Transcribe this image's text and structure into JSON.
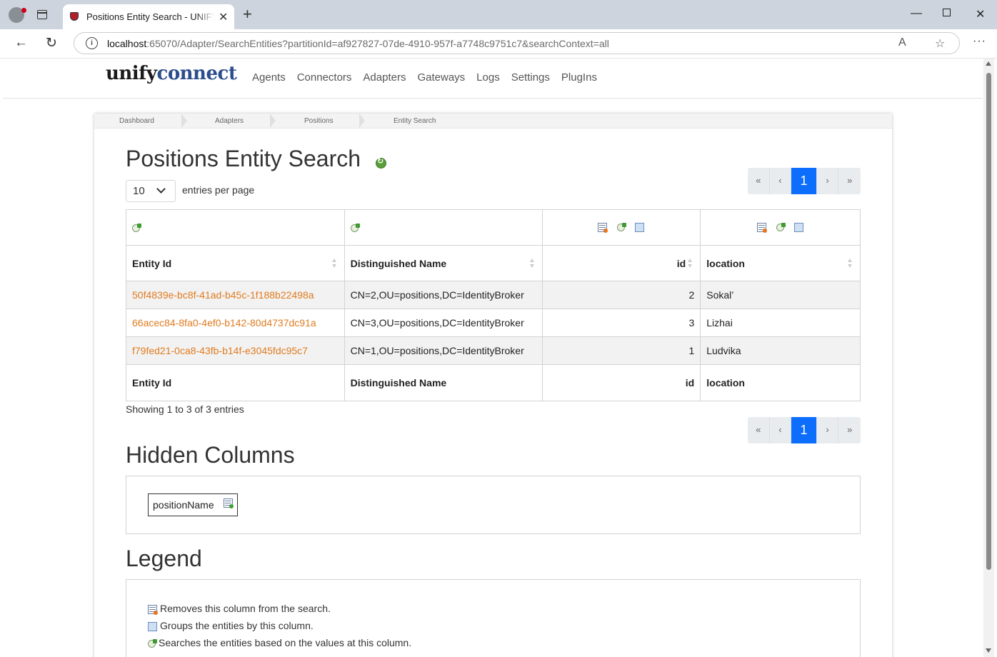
{
  "browser": {
    "tab_title": "Positions Entity Search - UNIFYConnect",
    "url_host": "localhost",
    "url_rest": ":65070/Adapter/SearchEntities?partitionId=af927827-07de-4910-957f-a7748c9751c7&searchContext=all"
  },
  "header": {
    "logo_part1": "unify",
    "logo_part2": "connect",
    "nav": [
      "Agents",
      "Connectors",
      "Adapters",
      "Gateways",
      "Logs",
      "Settings",
      "PlugIns"
    ]
  },
  "breadcrumb": [
    "Dashboard",
    "Adapters",
    "Positions",
    "Entity Search"
  ],
  "page": {
    "title": "Positions Entity Search",
    "entries_per_page_value": "10",
    "entries_per_page_label": "entries per page",
    "showing": "Showing 1 to 3 of 3 entries",
    "hidden_columns_title": "Hidden Columns",
    "legend_title": "Legend"
  },
  "pager": {
    "first": "«",
    "prev": "‹",
    "current": "1",
    "next": "›",
    "last": "»"
  },
  "table": {
    "columns": [
      "Entity Id",
      "Distinguished Name",
      "id",
      "location"
    ],
    "rows": [
      [
        "50f4839e-bc8f-41ad-b45c-1f188b22498a",
        "CN=2,OU=positions,DC=IdentityBroker",
        "2",
        "Sokal’"
      ],
      [
        "66acec84-8fa0-4ef0-b142-80d4737dc91a",
        "CN=3,OU=positions,DC=IdentityBroker",
        "3",
        "Lizhai"
      ],
      [
        "f79fed21-0ca8-43fb-b14f-e3045fdc95c7",
        "CN=1,OU=positions,DC=IdentityBroker",
        "1",
        "Ludvika"
      ]
    ]
  },
  "hidden_columns": [
    "positionName"
  ],
  "legend": [
    {
      "icon": "remove-column-icon",
      "text": "Removes this column from the search."
    },
    {
      "icon": "group-icon",
      "text": "Groups the entities by this column."
    },
    {
      "icon": "search-icon",
      "text": "Searches the entities based on the values at this column."
    }
  ]
}
